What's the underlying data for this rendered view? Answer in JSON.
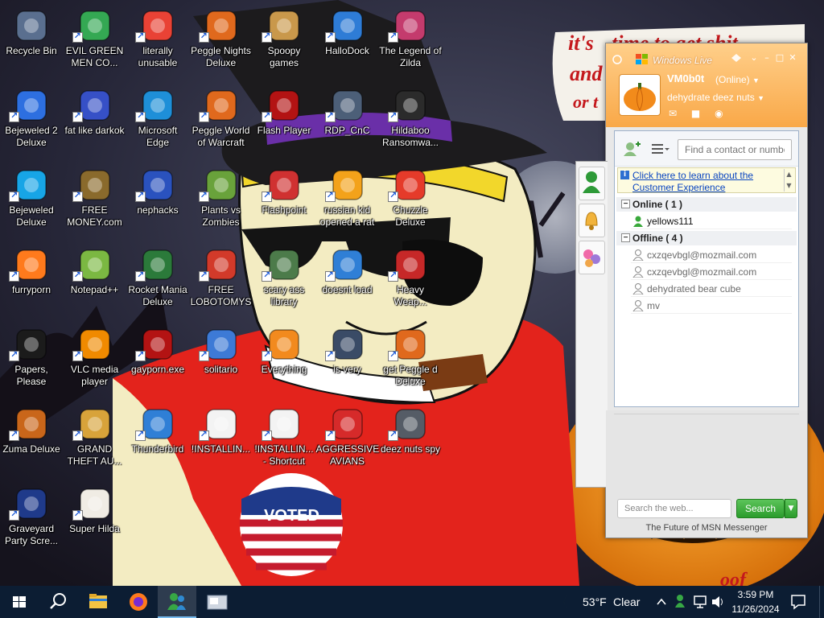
{
  "wallpaper": {
    "speech_text": "it's time to get shit and or t",
    "pumpkin_text": "oof"
  },
  "desktop_icons": [
    {
      "label": "Recycle Bin",
      "icon": "recycle-bin-icon"
    },
    {
      "label": "EVIL GREEN MEN CO...",
      "icon": "msn-buddies-icon"
    },
    {
      "label": "literally unusable",
      "icon": "chrome-icon"
    },
    {
      "label": "Peggle Nights Deluxe",
      "icon": "peggle-icon"
    },
    {
      "label": "Spoopy games",
      "icon": "folder-icon"
    },
    {
      "label": "HalloDock",
      "icon": "windows-shield-icon"
    },
    {
      "label": "The Legend of Zilda",
      "icon": "zelda-icon"
    },
    {
      "label": "Bejeweled 2 Deluxe",
      "icon": "bejeweled2-icon"
    },
    {
      "label": "fat like darkok",
      "icon": "mpl-icon"
    },
    {
      "label": "Microsoft Edge",
      "icon": "edge-icon"
    },
    {
      "label": "Peggle World of Warcraft",
      "icon": "peggle-icon"
    },
    {
      "label": "Flash Player",
      "icon": "flash-icon"
    },
    {
      "label": "RDP_CnC",
      "icon": "rdp-icon"
    },
    {
      "label": "Hildaboo Ransomwa...",
      "icon": "yashma-icon"
    },
    {
      "label": "Bejeweled Deluxe",
      "icon": "gem-icon"
    },
    {
      "label": "FREE MONEY.com",
      "icon": "money-bag-icon"
    },
    {
      "label": "nephacks",
      "icon": "mpi-icon"
    },
    {
      "label": "Plants vs Zombies",
      "icon": "pvz-icon"
    },
    {
      "label": "Flashpoint",
      "icon": "flashpoint-icon"
    },
    {
      "label": "russian kid opened a rat",
      "icon": "de-icon"
    },
    {
      "label": "Chuzzle Deluxe",
      "icon": "chuzzle-icon"
    },
    {
      "label": "furryporn",
      "icon": "firefox-icon"
    },
    {
      "label": "Notepad++",
      "icon": "notepadpp-icon"
    },
    {
      "label": "Rocket Mania Deluxe",
      "icon": "rocket-icon"
    },
    {
      "label": "FREE LOBOTOMYS",
      "icon": "clock-icon"
    },
    {
      "label": "scary ass library",
      "icon": "library-icon"
    },
    {
      "label": "doesnt load",
      "icon": "thunderbird-icon"
    },
    {
      "label": "Heavy Weap...",
      "icon": "radiation-icon"
    },
    {
      "label": "Papers, Please",
      "icon": "papers-please-icon"
    },
    {
      "label": "VLC media player",
      "icon": "vlc-icon"
    },
    {
      "label": "gayporn.exe",
      "icon": "flash-icon"
    },
    {
      "label": "solitario",
      "icon": "solitaire-icon"
    },
    {
      "label": "Everything",
      "icon": "everything-icon"
    },
    {
      "label": "is very",
      "icon": "mpl-shield-icon"
    },
    {
      "label": "get Peggle d Deluxe",
      "icon": "peggle-icon"
    },
    {
      "label": "Zuma Deluxe",
      "icon": "zuma-icon"
    },
    {
      "label": "GRAND THEFT AU...",
      "icon": "gta-icon"
    },
    {
      "label": "Thunderbird",
      "icon": "thunderbird-icon"
    },
    {
      "label": "!INSTALLIN...",
      "icon": "text-file-icon"
    },
    {
      "label": "!INSTALLIN... - Shortcut",
      "icon": "text-file-icon"
    },
    {
      "label": "AGGRESSIVE AVIANS",
      "icon": "angry-bird-icon"
    },
    {
      "label": "deez nuts spy",
      "icon": "windows-stack-icon"
    },
    {
      "label": "Graveyard Party Scre...",
      "icon": "voted-badge-icon"
    },
    {
      "label": "Super Hilda",
      "icon": "pixel-cat-icon"
    }
  ],
  "msn": {
    "brand": "Windows Live",
    "window_controls": [
      "⌄",
      "–",
      "□",
      "✕"
    ],
    "username": "VM0b0t",
    "status": "(Online)",
    "personal_message": "dehydrate deez nuts",
    "find_placeholder": "Find a contact or number",
    "customer_link": "Click here to learn about the Customer Experience",
    "groups": [
      {
        "label": "Online ( 1 )",
        "contacts": [
          "yellows111"
        ],
        "status": "online"
      },
      {
        "label": "Offline ( 4 )",
        "contacts": [
          "cxzqevbgl@mozmail.com",
          "cxzqevbgl@mozmail.com",
          "dehydrated bear cube",
          "mv"
        ],
        "status": "offline"
      }
    ],
    "web_search_placeholder": "Search the web...",
    "search_label": "Search",
    "footer": "The Future of MSN Messenger"
  },
  "taskbar": {
    "weather_temp": "53°F",
    "weather_desc": "Clear",
    "time": "3:59 PM",
    "date": "11/26/2024"
  },
  "colors": {
    "msn_orange": "#f9a848",
    "taskbar": "#0c1d33",
    "search_green": "#2b9c2c"
  }
}
